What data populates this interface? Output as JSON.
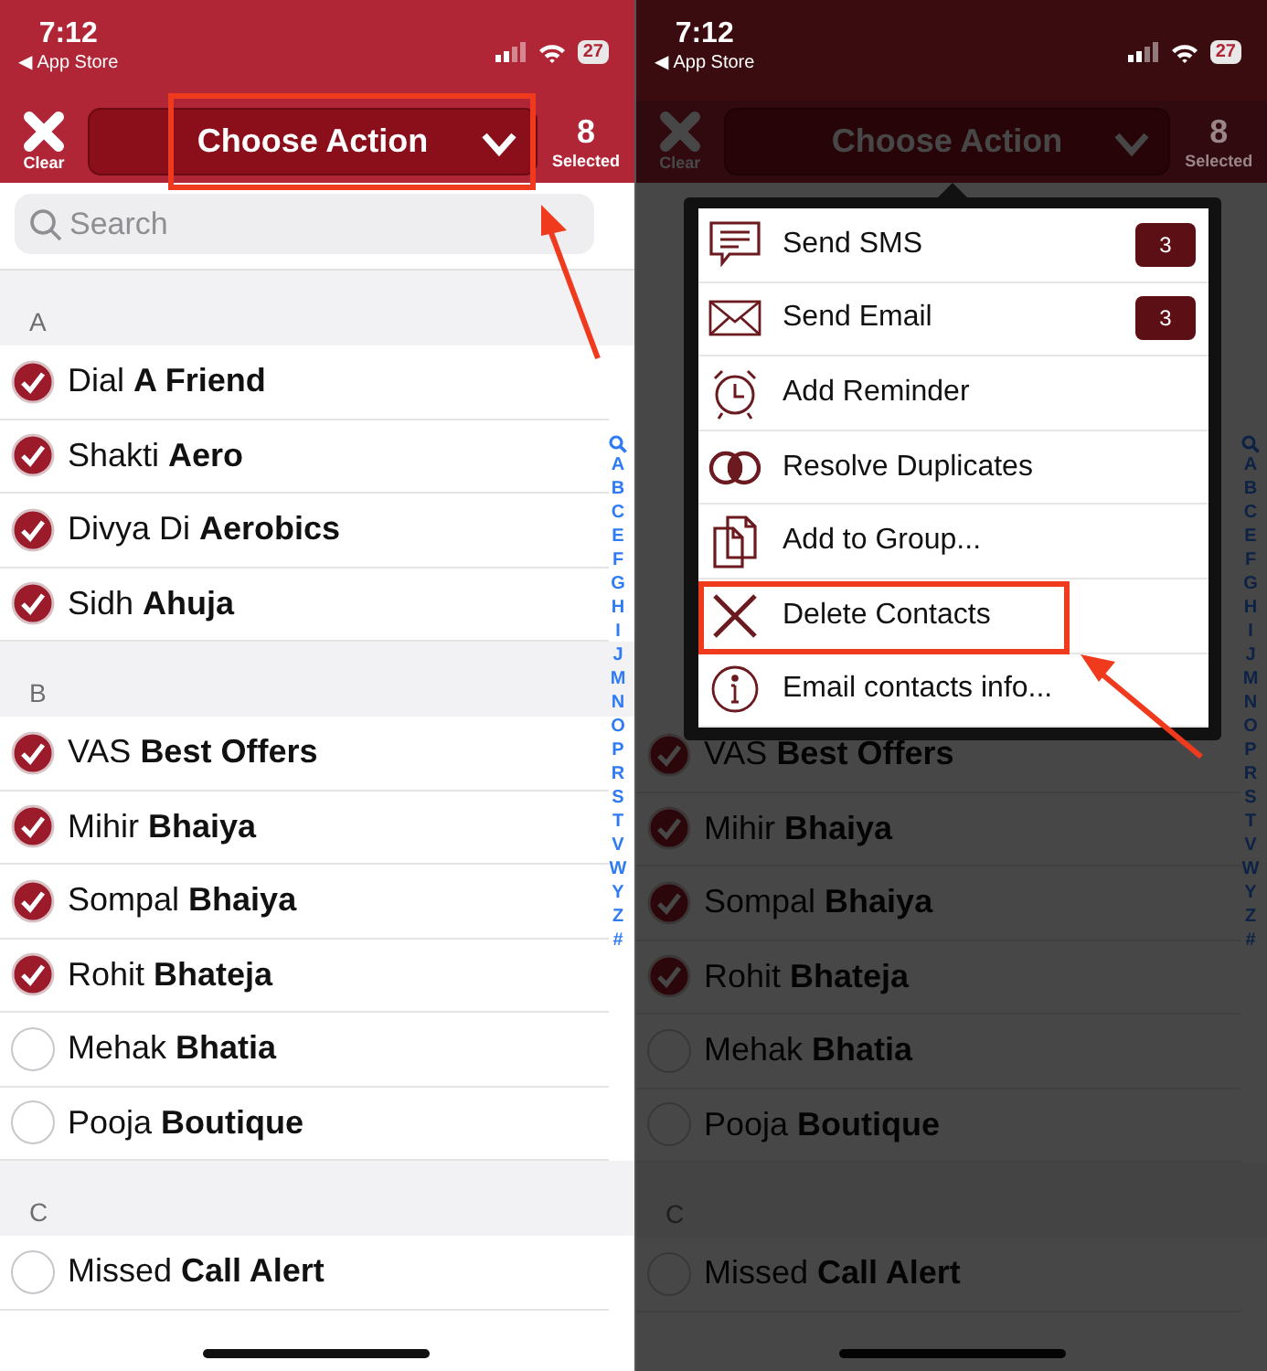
{
  "screens": [
    {
      "status": {
        "time": "7:12",
        "back": "◀ App Store",
        "battery": "27"
      },
      "header": {
        "clear_label": "Clear",
        "action_label": "Choose Action",
        "count": "8",
        "count_label": "Selected",
        "highlighted": true
      },
      "search": {
        "placeholder": "Search"
      },
      "dimmed": false,
      "sections": [
        {
          "title": "A",
          "rows": [
            {
              "name": "Dial **A Friend**",
              "checked": true
            },
            {
              "name": "Shakti **Aero**",
              "checked": true
            },
            {
              "name": "Divya Di **Aerobics**",
              "checked": true
            },
            {
              "name": "Sidh **Ahuja**",
              "checked": true
            }
          ]
        },
        {
          "title": "B",
          "rows": [
            {
              "name": "VAS **Best Offers**",
              "checked": true
            },
            {
              "name": "Mihir **Bhaiya**",
              "checked": true
            },
            {
              "name": "Sompal **Bhaiya**",
              "checked": true
            },
            {
              "name": "Rohit **Bhateja**",
              "checked": true
            },
            {
              "name": "Mehak **Bhatia**",
              "checked": false
            },
            {
              "name": "Pooja **Boutique**",
              "checked": false
            }
          ]
        },
        {
          "title": "C",
          "rows": [
            {
              "name": "Missed **Call Alert**",
              "checked": false
            }
          ]
        }
      ],
      "index": [
        "A",
        "B",
        "C",
        "E",
        "F",
        "G",
        "H",
        "I",
        "J",
        "M",
        "N",
        "O",
        "P",
        "R",
        "S",
        "T",
        "V",
        "W",
        "Y",
        "Z",
        "#"
      ]
    },
    {
      "status": {
        "time": "7:12",
        "back": "◀ App Store",
        "battery": "27"
      },
      "header": {
        "clear_label": "Clear",
        "action_label": "Choose Action",
        "count": "8",
        "count_label": "Selected",
        "highlighted": false
      },
      "dimmed": true,
      "sections": [
        {
          "rows": [
            {
              "name": "VAS **Best Offers**",
              "checked": true
            },
            {
              "name": "Mihir **Bhaiya**",
              "checked": true
            },
            {
              "name": "Sompal **Bhaiya**",
              "checked": true
            },
            {
              "name": "Rohit **Bhateja**",
              "checked": true
            },
            {
              "name": "Mehak **Bhatia**",
              "checked": false
            },
            {
              "name": "Pooja **Boutique**",
              "checked": false
            }
          ]
        },
        {
          "title": "C",
          "rows": [
            {
              "name": "Missed **Call Alert**",
              "checked": false
            }
          ]
        }
      ],
      "index": [
        "A",
        "B",
        "C",
        "E",
        "F",
        "G",
        "H",
        "I",
        "J",
        "M",
        "N",
        "O",
        "P",
        "R",
        "S",
        "T",
        "V",
        "W",
        "Y",
        "Z",
        "#"
      ],
      "menu": {
        "items": [
          {
            "kind": "sms",
            "label": "Send SMS",
            "badge": "3",
            "highlighted": false
          },
          {
            "kind": "mail",
            "label": "Send Email",
            "badge": "3",
            "highlighted": false
          },
          {
            "kind": "alarm",
            "label": "Add Reminder",
            "highlighted": false
          },
          {
            "kind": "rings",
            "label": "Resolve Duplicates",
            "highlighted": false
          },
          {
            "kind": "pages",
            "label": "Add to Group...",
            "highlighted": false
          },
          {
            "kind": "cross",
            "label": "Delete Contacts",
            "highlighted": true
          },
          {
            "kind": "info",
            "label": "Email contacts info...",
            "highlighted": false
          }
        ]
      }
    }
  ]
}
